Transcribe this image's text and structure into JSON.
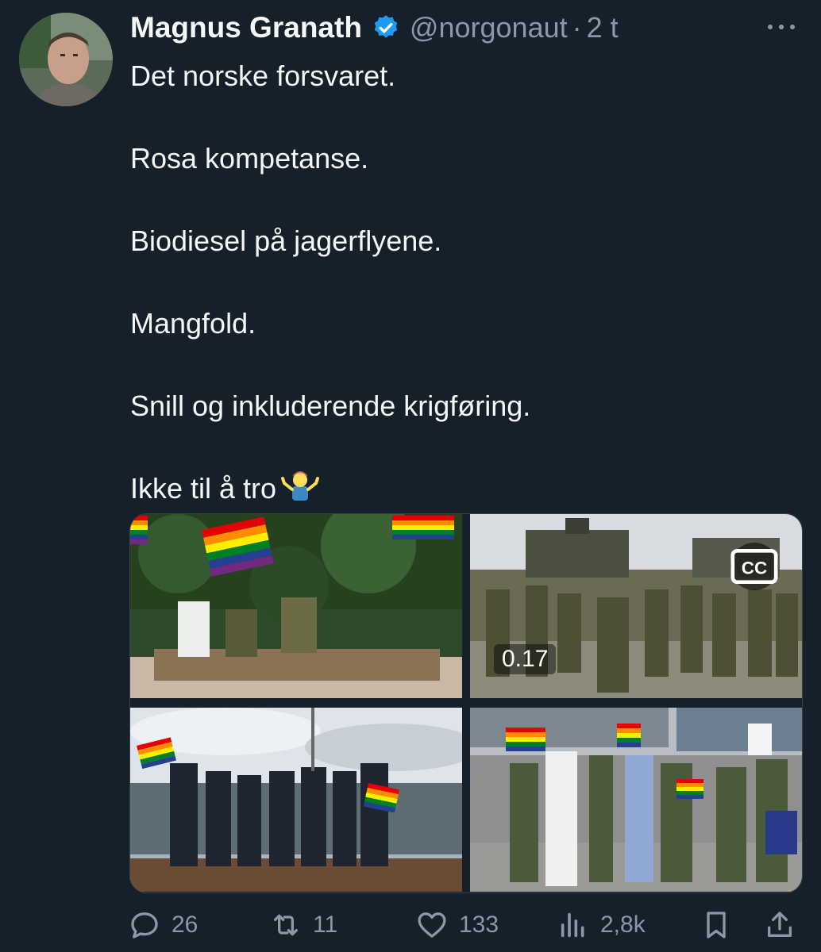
{
  "author": {
    "name": "Magnus Granath",
    "handle": "@norgonaut",
    "separator": "·",
    "time": "2 t"
  },
  "tweet": {
    "lines": [
      "Det norske forsvaret.",
      "Rosa kompetanse.",
      "Biodiesel på jagerflyene.",
      "Mangfold.",
      "Snill og inkluderende krigføring.",
      "Ikke til å tro"
    ],
    "emoji": "shrug-person-emoji"
  },
  "media": {
    "video_time": "0.17",
    "cc_label": "CC"
  },
  "actions": {
    "replies": "26",
    "retweets": "11",
    "likes": "133",
    "views": "2,8k"
  },
  "icons": [
    "verified-badge-icon",
    "more-icon",
    "reply-icon",
    "retweet-icon",
    "like-icon",
    "views-icon",
    "bookmark-icon",
    "share-icon",
    "cc-icon"
  ],
  "colors": {
    "background": "#15202b",
    "text": "#f7f9f9",
    "muted": "#8b98a5",
    "verified": "#1d9bf0"
  }
}
